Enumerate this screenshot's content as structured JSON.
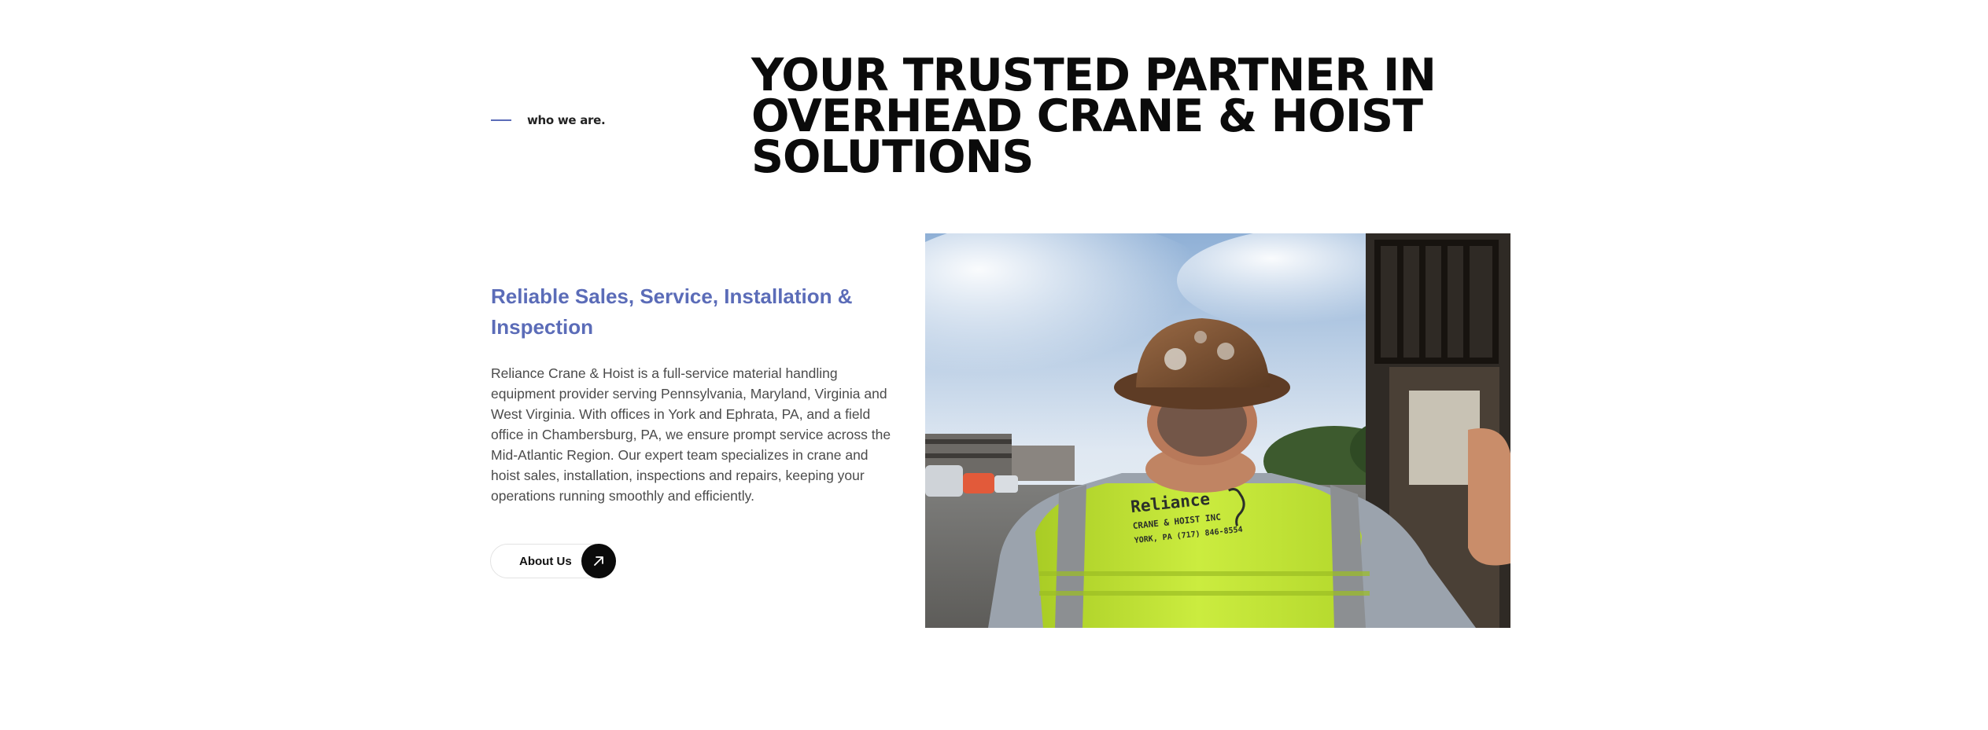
{
  "section": {
    "eyebrow": "who we are.",
    "headline": "YOUR TRUSTED PARTNER IN OVERHEAD CRANE & HOIST SOLUTIONS",
    "subhead": "Reliable Sales, Service, Installation & Inspection",
    "body": "Reliance Crane & Hoist is a full-service material handling equipment provider serving Pennsylvania, Maryland, Virginia and West Virginia. With offices in York and Ephrata, PA, and a field office in Chambersburg, PA, we ensure prompt service across the Mid-Atlantic Region. Our expert team specializes in crane and hoist sales, installation, inspections and repairs, keeping your operations running smoothly and efficiently.",
    "button_label": "About Us",
    "button_icon": "arrow-up-right-icon"
  },
  "photo": {
    "vest_text_line1": "Reliance",
    "vest_text_line2": "CRANE & HOIST INC",
    "vest_text_line3": "YORK, PA (717) 846-8554"
  },
  "colors": {
    "accent": "#5b6cb8",
    "heading": "#0b0b0b",
    "body": "#4b4b4b",
    "vest": "#c6e83a",
    "button_icon_bg": "#0b0b0b"
  }
}
